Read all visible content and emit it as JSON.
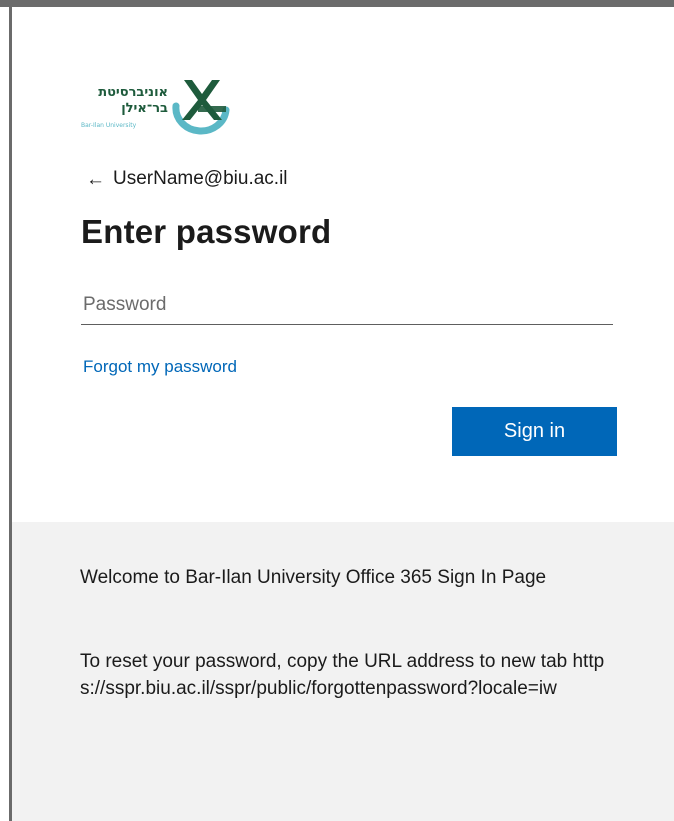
{
  "branding": {
    "logo_text_hebrew_line1": "אוניברסיטת",
    "logo_text_hebrew_line2": "בר־אילן",
    "logo_text_english": "Bar-Ilan University",
    "accent_green": "#1e5b3c",
    "accent_teal": "#5bb8c6",
    "icon": "bar-ilan-logo"
  },
  "identity": {
    "back_icon": "arrow-left-icon",
    "username": "UserName@biu.ac.il"
  },
  "form": {
    "title": "Enter password",
    "password_placeholder": "Password",
    "password_value": "",
    "forgot_link": "Forgot my password",
    "signin_label": "Sign in",
    "button_color": "#0067b8"
  },
  "footer": {
    "welcome": "Welcome to Bar-Ilan University Office 365 Sign In Page",
    "reset_info": "To reset your password, copy the URL address to new tab https://sspr.biu.ac.il/sspr/public/forgottenpassword?locale=iw"
  }
}
